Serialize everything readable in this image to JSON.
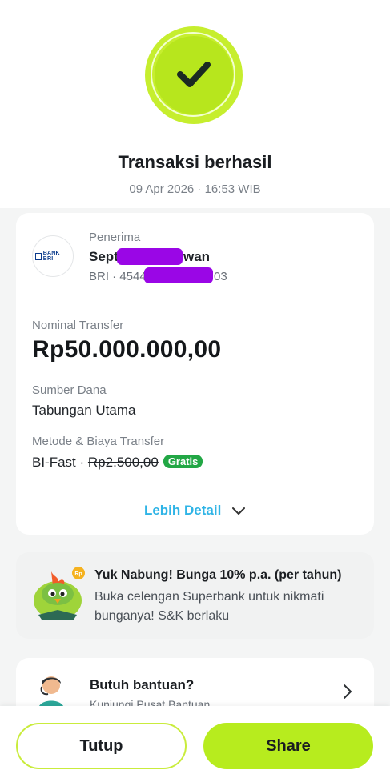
{
  "status": {
    "title": "Transaksi berhasil",
    "datetime": "09 Apr 2026 · 16:53 WIB",
    "icon": "check-icon",
    "accent_color": "#b7e61d"
  },
  "recipient": {
    "label": "Penerima",
    "name_start": "Sept",
    "name_end": "wan",
    "account_start": "BRI · 4544",
    "account_end": "03",
    "bank_logo_text": "BANK BRI"
  },
  "transfer": {
    "amount_label": "Nominal Transfer",
    "amount": "Rp50.000.000,00",
    "source_label": "Sumber Dana",
    "source": "Tabungan Utama",
    "method_label": "Metode & Biaya Transfer",
    "method": "BI-Fast · ",
    "fee_original": "Rp2.500,00",
    "fee_badge": "Gratis",
    "more_detail": "Lebih Detail"
  },
  "promo": {
    "title": "Yuk Nabung! Bunga 10% p.a. (per tahun)",
    "body": "Buka celengan Superbank untuk nikmati bunganya! S&K berlaku",
    "coin_text": "Rp"
  },
  "help": {
    "title": "Butuh bantuan?",
    "subtitle": "Kunjungi Pusat Bantuan"
  },
  "actions": {
    "close_label": "Tutup",
    "share_label": "Share"
  }
}
